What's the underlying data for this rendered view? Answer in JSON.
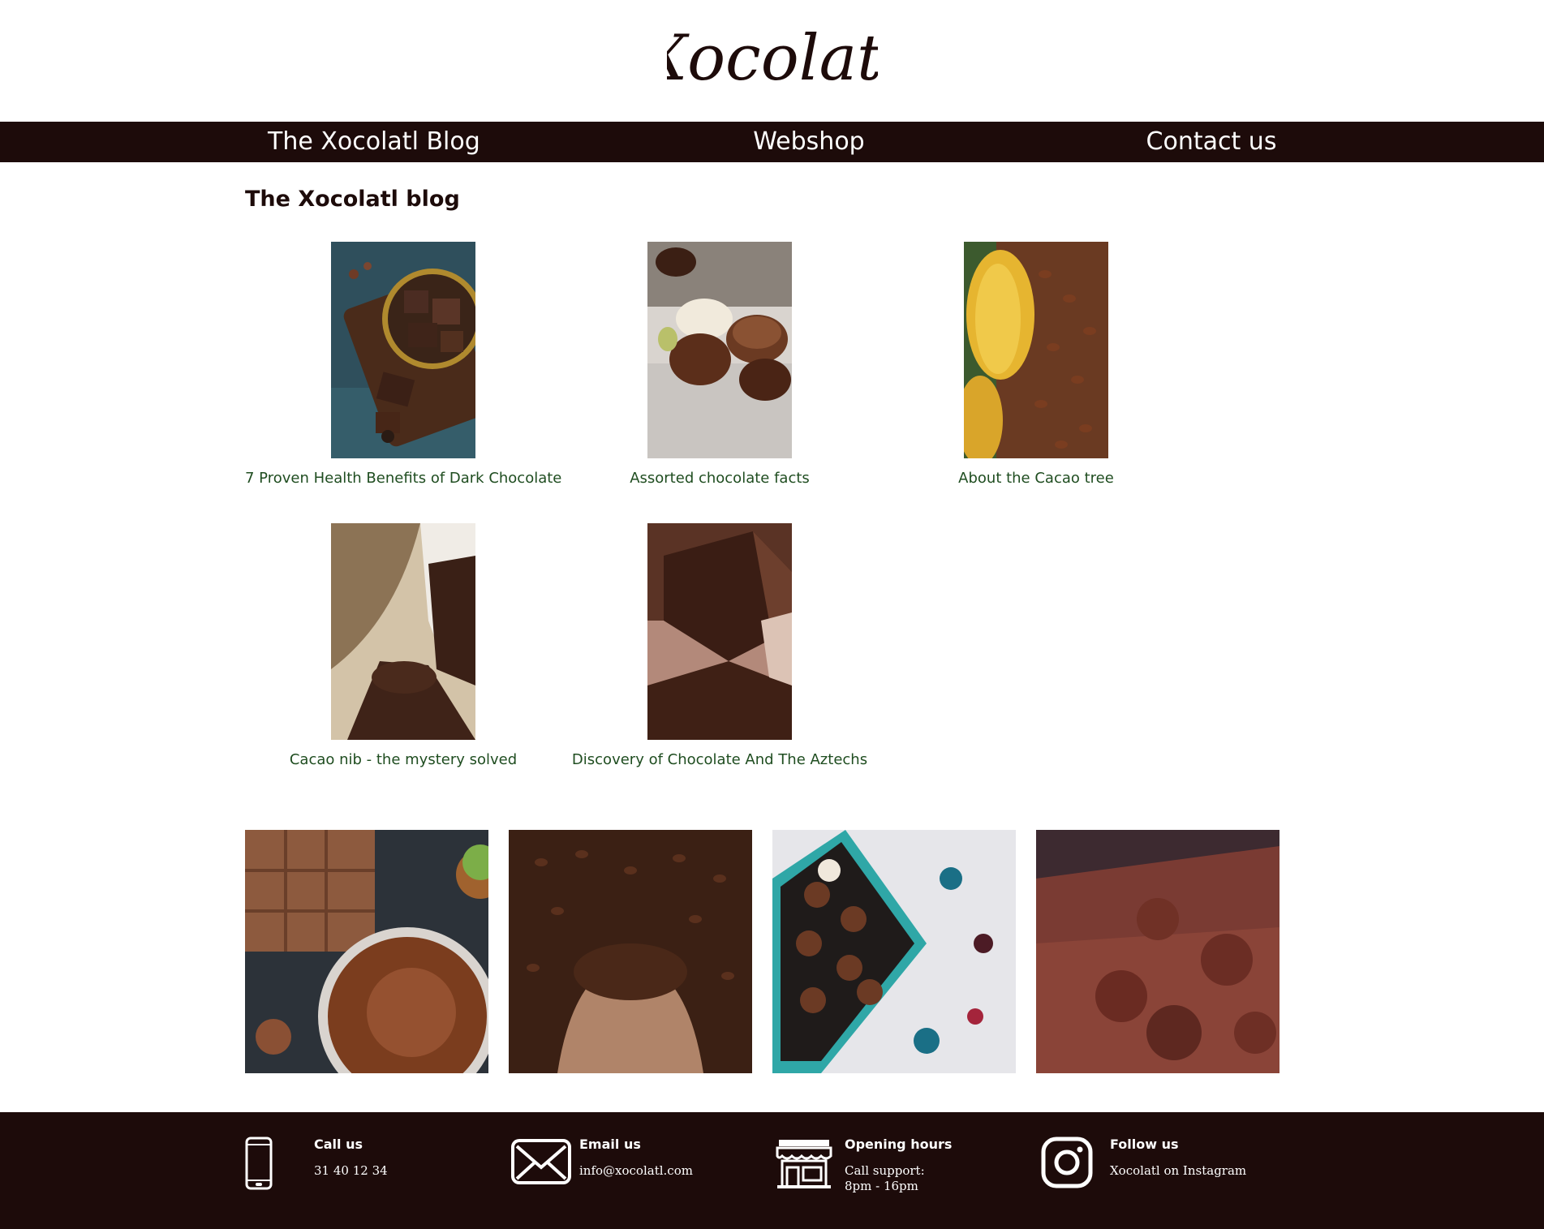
{
  "brand": {
    "logo_text": "Xocolatl"
  },
  "nav": {
    "items": [
      {
        "label": "The Xocolatl Blog"
      },
      {
        "label": "Webshop"
      },
      {
        "label": "Contact us"
      }
    ]
  },
  "main": {
    "title": "The Xocolatl blog",
    "posts": [
      {
        "title": "7 Proven Health Benefits of Dark Chocolate"
      },
      {
        "title": "Assorted chocolate facts"
      },
      {
        "title": "About the Cacao tree"
      },
      {
        "title": "Cacao nib - the mystery solved"
      },
      {
        "title": "Discovery of Chocolate And The Aztechs"
      }
    ]
  },
  "footer": {
    "call": {
      "title": "Call us",
      "text": "31 40 12 34",
      "icon": "phone-icon"
    },
    "email": {
      "title": "Email us",
      "text": "info@xocolatl.com",
      "icon": "envelope-icon"
    },
    "hours": {
      "title": "Opening hours",
      "line1": "Call support:",
      "line2": "8pm - 16pm",
      "icon": "shop-icon"
    },
    "follow": {
      "title": "Follow us",
      "text": "Xocolatl on Instagram",
      "icon": "instagram-icon"
    }
  },
  "colors": {
    "brand_dark": "#1d0b0a",
    "link_green": "#1f4d20",
    "background": "#ffffff"
  }
}
